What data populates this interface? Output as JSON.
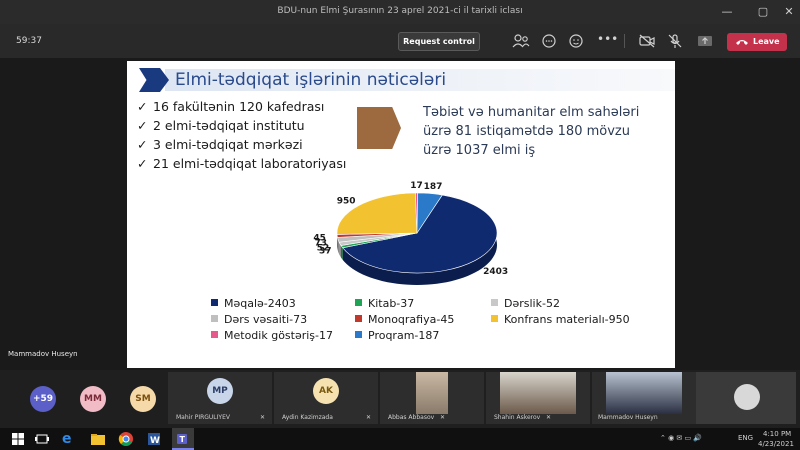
{
  "window": {
    "title": "BDU-nun Elmi Şurasının 23 aprel 2021-ci il tarixli iclası"
  },
  "toolbar": {
    "timer": "59:37",
    "request_control_label": "Request control",
    "leave_label": "Leave"
  },
  "slide": {
    "title": "Elmi-tədqiqat işlərinin nəticələri",
    "bullets": [
      "16 fakültənin 120 kafedrası",
      "2 elmi-tədqiqat institutu",
      "3 elmi-tədqiqat mərkəzi",
      "21 elmi-tədqiqat laboratoriyası"
    ],
    "right_text": [
      "Təbiət və humanitar elm sahələri",
      "üzrə 81 istiqamətdə 180 mövzu",
      "üzrə 1037 elmi iş"
    ]
  },
  "chart_data": {
    "type": "pie",
    "categories": [
      "Məqalə",
      "Kitab",
      "Dərslik",
      "Dərs vəsaiti",
      "Monoqrafiya",
      "Konfrans materialı",
      "Metodik göstəriş",
      "Proqram"
    ],
    "values": [
      2403,
      37,
      52,
      73,
      45,
      950,
      17,
      187
    ],
    "colors": [
      "#0f2a6e",
      "#1fa355",
      "#c8c8c8",
      "#bfbfbf",
      "#c0392b",
      "#f2c230",
      "#e5598c",
      "#2a7ac9"
    ],
    "legend": [
      "Məqalə-2403",
      "Kitab-37",
      "Dərslik-52",
      "Dərs vəsaiti-73",
      "Monoqrafiya-45",
      "Konfrans materialı-950",
      "Metodik göstəriş-17",
      "Proqram-187"
    ],
    "labels": [
      "2403",
      "37",
      "52",
      "73",
      "45",
      "950",
      "17",
      "187"
    ]
  },
  "presenter": {
    "name": "Mammadov Huseyn"
  },
  "participants": {
    "more_count": "+59",
    "initials_circles": [
      "MM",
      "SM"
    ],
    "tiles": [
      {
        "initials": "MP",
        "name": "Mahir PIRGULIYEV"
      },
      {
        "initials": "AK",
        "name": "Aydin Kazimzada"
      },
      {
        "name": "Abbas Abbasov"
      },
      {
        "name": "Shahin Askerov"
      },
      {
        "name": "Mammadov Huseyn"
      }
    ]
  },
  "taskbar": {
    "language": "ENG",
    "time": "4:10 PM",
    "date": "4/23/2021"
  }
}
